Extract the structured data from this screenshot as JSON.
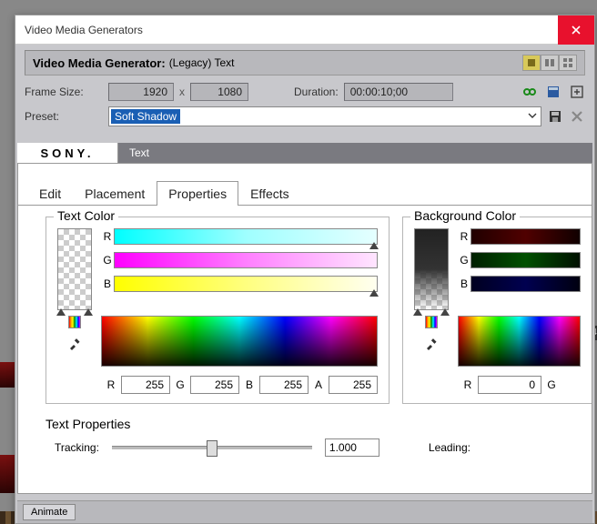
{
  "window": {
    "title": "Video Media Generators"
  },
  "generator": {
    "label": "Video Media Generator:",
    "name": "(Legacy) Text"
  },
  "frame": {
    "label": "Frame Size:",
    "width": "1920",
    "height": "1080",
    "sep": "x"
  },
  "duration": {
    "label": "Duration:",
    "value": "00:00:10;00"
  },
  "preset": {
    "label": "Preset:",
    "value": "Soft Shadow"
  },
  "brandTab": "SONY.",
  "topTabs": {
    "text": "Text"
  },
  "subtabs": {
    "edit": "Edit",
    "placement": "Placement",
    "properties": "Properties",
    "effects": "Effects"
  },
  "textColor": {
    "title": "Text Color",
    "rLabel": "R",
    "gLabel": "G",
    "bLabel": "B",
    "aLabel": "A",
    "r": "255",
    "g": "255",
    "b": "255",
    "a": "255"
  },
  "bgColor": {
    "title": "Background Color",
    "rLabel": "R",
    "gLabel": "G",
    "bLabel": "B",
    "r": "0"
  },
  "textProps": {
    "title": "Text Properties",
    "trackingLabel": "Tracking:",
    "trackingValue": "1.000",
    "leadingLabel": "Leading:"
  },
  "animate": "Animate",
  "cropped": {
    "n": "4"
  }
}
